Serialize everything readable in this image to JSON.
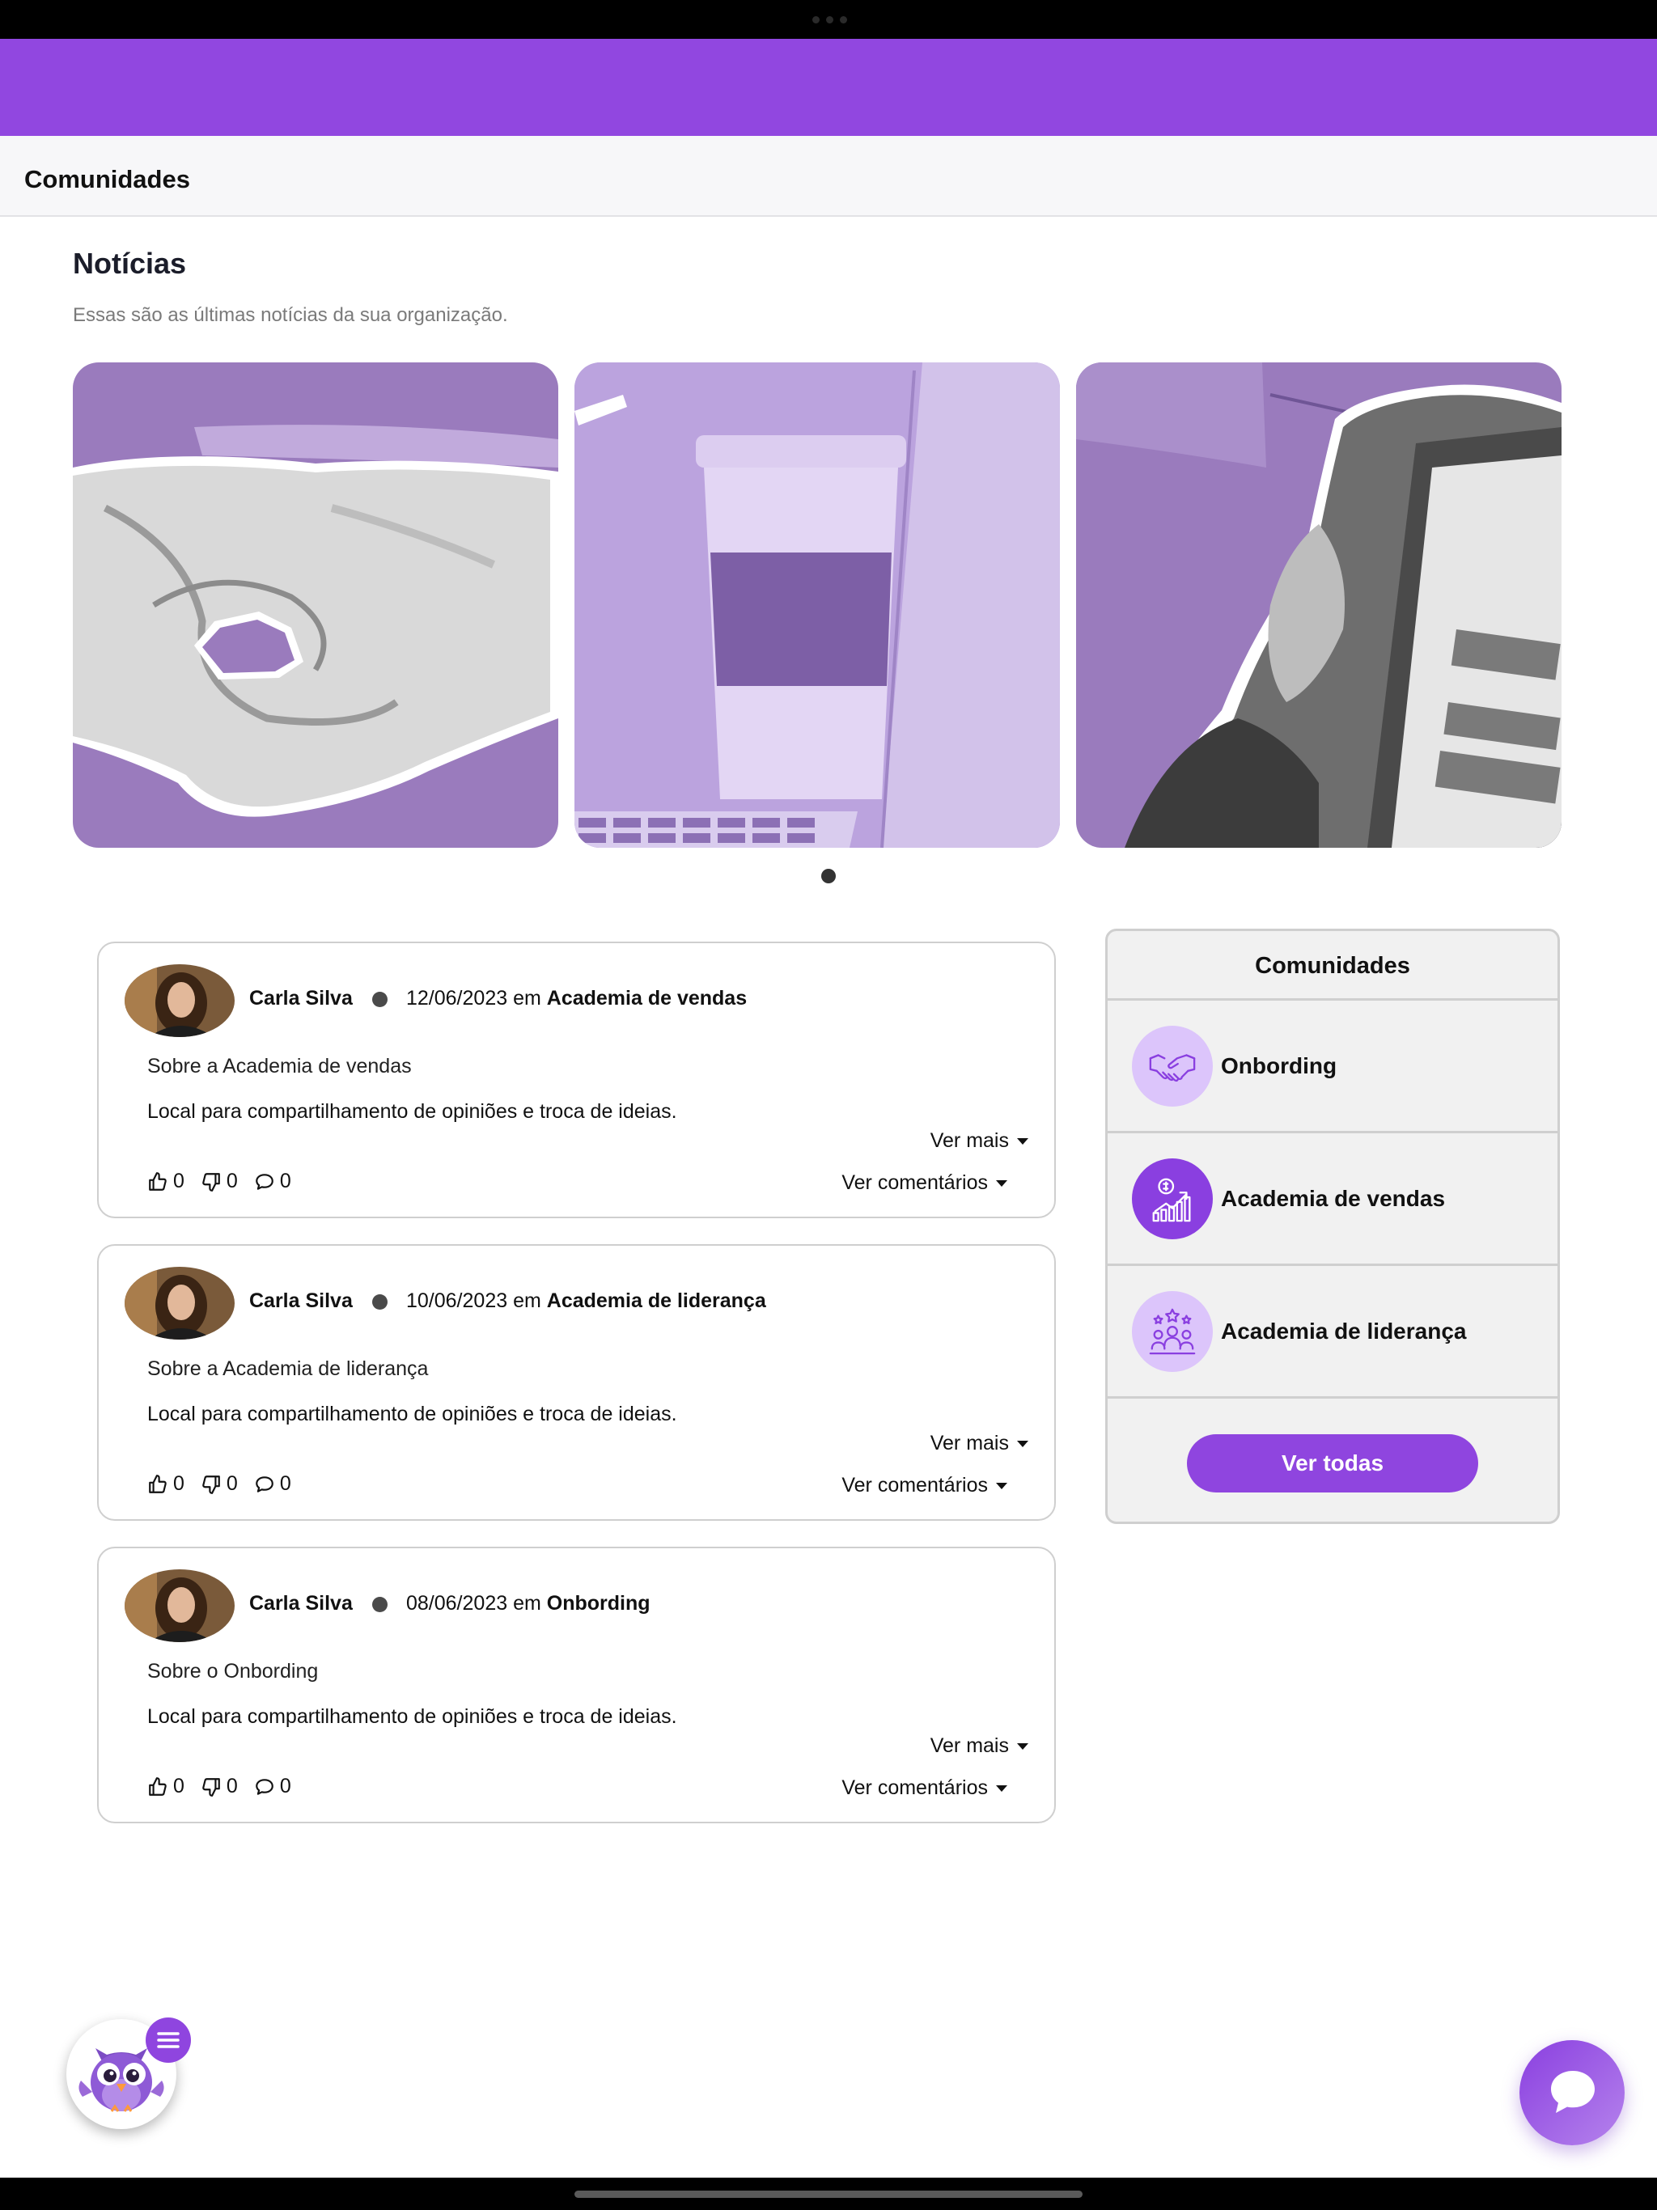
{
  "subheader": {
    "title": "Comunidades"
  },
  "news": {
    "title": "Notícias",
    "subtitle": "Essas são as últimas notícias da sua organização.",
    "carousel": {
      "slide_count": 1,
      "active_index": 0
    }
  },
  "posts": [
    {
      "author": "Carla Silva",
      "date": "12/06/2023",
      "in_word": "em",
      "community": "Academia de vendas",
      "about": "Sobre a Academia de vendas",
      "body": "Local para compartilhamento de opiniões e troca de ideias.",
      "see_more": "Ver mais",
      "likes": "0",
      "dislikes": "0",
      "comments": "0",
      "see_comments": "Ver comentários"
    },
    {
      "author": "Carla Silva",
      "date": "10/06/2023",
      "in_word": "em",
      "community": "Academia de liderança",
      "about": "Sobre a Academia de liderança",
      "body": "Local para compartilhamento de opiniões e troca de ideias.",
      "see_more": "Ver mais",
      "likes": "0",
      "dislikes": "0",
      "comments": "0",
      "see_comments": "Ver comentários"
    },
    {
      "author": "Carla Silva",
      "date": "08/06/2023",
      "in_word": "em",
      "community": "Onbording",
      "about": "Sobre o Onbording",
      "body": "Local para compartilhamento de opiniões e troca de ideias.",
      "see_more": "Ver mais",
      "likes": "0",
      "dislikes": "0",
      "comments": "0",
      "see_comments": "Ver comentários"
    }
  ],
  "communities": {
    "title": "Comunidades",
    "items": [
      {
        "name": "Onbording",
        "icon": "handshake-icon"
      },
      {
        "name": "Academia de vendas",
        "icon": "sales-growth-icon"
      },
      {
        "name": "Academia de liderança",
        "icon": "team-leadership-icon"
      }
    ],
    "see_all": "Ver todas"
  },
  "icons": {
    "like": "thumbs-up-icon",
    "dislike": "thumbs-down-icon",
    "comment": "comment-icon",
    "menu": "menu-icon",
    "chat": "chat-icon",
    "mascot": "owl-mascot-icon"
  },
  "colors": {
    "brand": "#9147e0",
    "button": "#8f45df",
    "icon_light_bg": "#dcc5fb",
    "panel_bg": "#f1f1f1"
  }
}
